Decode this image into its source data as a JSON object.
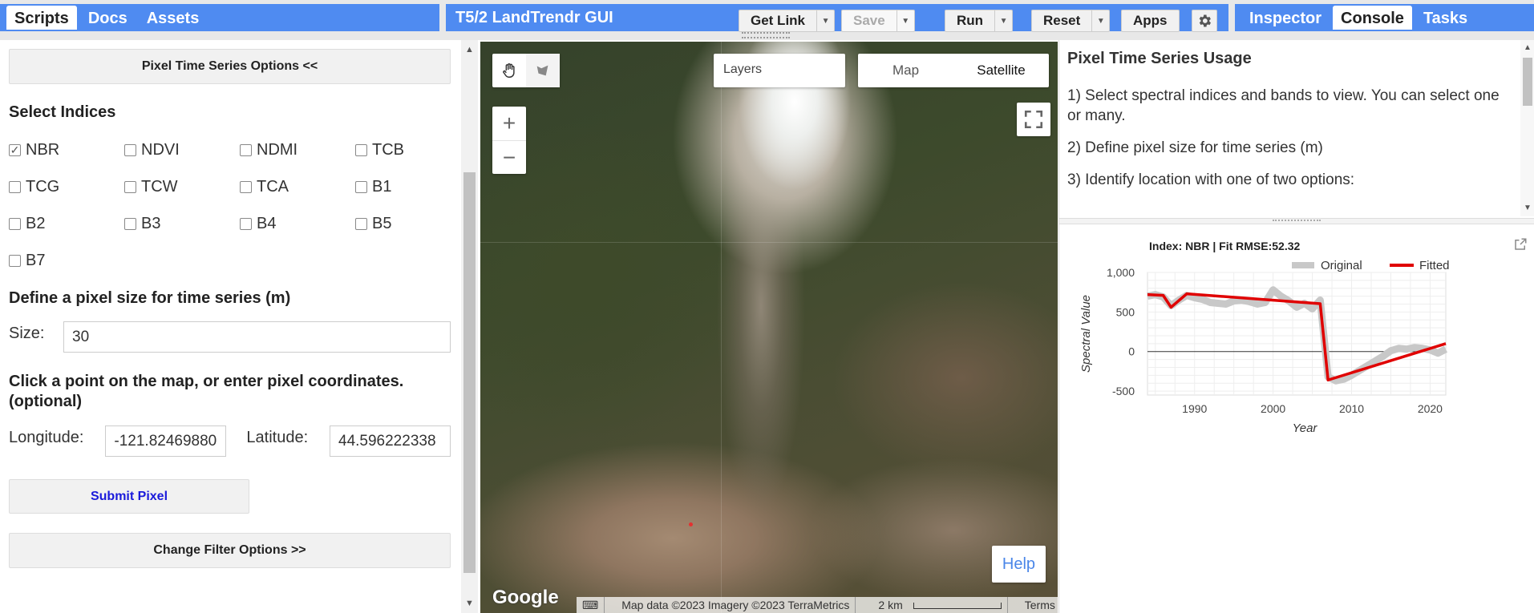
{
  "left_tabs": [
    "Scripts",
    "Docs",
    "Assets"
  ],
  "right_tabs": [
    "Inspector",
    "Console",
    "Tasks"
  ],
  "toolbar": {
    "title": "T5/2 LandTrendr GUI",
    "get_link": "Get Link",
    "save": "Save",
    "run": "Run",
    "reset": "Reset",
    "apps": "Apps"
  },
  "left_panel": {
    "options_button": "Pixel Time Series Options <<",
    "select_indices_heading": "Select Indices",
    "indices": [
      {
        "label": "NBR",
        "checked": true
      },
      {
        "label": "NDVI",
        "checked": false
      },
      {
        "label": "NDMI",
        "checked": false
      },
      {
        "label": "TCB",
        "checked": false
      },
      {
        "label": "TCG",
        "checked": false
      },
      {
        "label": "TCW",
        "checked": false
      },
      {
        "label": "TCA",
        "checked": false
      },
      {
        "label": "B1",
        "checked": false
      },
      {
        "label": "B2",
        "checked": false
      },
      {
        "label": "B3",
        "checked": false
      },
      {
        "label": "B4",
        "checked": false
      },
      {
        "label": "B5",
        "checked": false
      },
      {
        "label": "B7",
        "checked": false
      }
    ],
    "pixel_size_heading": "Define a pixel size for time series (m)",
    "size_label": "Size:",
    "size_value": "30",
    "click_heading": "Click a point on the map, or enter pixel coordinates. (optional)",
    "longitude_label": "Longitude:",
    "longitude_value": "-121.82469880",
    "latitude_label": "Latitude:",
    "latitude_value": "44.596222338",
    "submit_button": "Submit Pixel",
    "filter_button": "Change Filter Options >>"
  },
  "map": {
    "layers_label": "Layers",
    "map_type": [
      "Map",
      "Satellite"
    ],
    "selected_map_type": "Satellite",
    "zoom_in": "+",
    "zoom_out": "−",
    "help": "Help",
    "google": "Google",
    "attribution": "Map data ©2023 Imagery ©2023 TerraMetrics",
    "scale": "2 km",
    "terms": "Terms of Use"
  },
  "right_panel": {
    "usage_title": "Pixel Time Series Usage",
    "usage_steps": [
      "1) Select spectral indices and bands to view. You can select one or many.",
      "2) Define pixel size for time series (m)",
      "3) Identify location with one of two options:"
    ]
  },
  "chart_data": {
    "type": "line",
    "title": "Index: NBR | Fit RMSE:52.32",
    "xlabel": "Year",
    "ylabel": "Spectral Value",
    "xlim": [
      1984,
      2022
    ],
    "ylim": [
      -550,
      1000
    ],
    "xticks": [
      1990,
      2000,
      2010,
      2020
    ],
    "yticks": [
      1000,
      500,
      0,
      -500
    ],
    "ytick_labels": [
      "1,000",
      "500",
      "0",
      "-500"
    ],
    "legend_position": "top-right",
    "series": [
      {
        "name": "Original",
        "color": "#c8c8c8",
        "x": [
          1984,
          1985,
          1986,
          1987,
          1988,
          1989,
          1990,
          1991,
          1992,
          1993,
          1994,
          1995,
          1996,
          1997,
          1998,
          1999,
          2000,
          2001,
          2002,
          2003,
          2004,
          2005,
          2006,
          2007,
          2008,
          2009,
          2010,
          2011,
          2012,
          2013,
          2014,
          2015,
          2016,
          2017,
          2018,
          2019,
          2020,
          2021,
          2022
        ],
        "y": [
          700,
          720,
          690,
          580,
          650,
          710,
          680,
          660,
          620,
          610,
          600,
          640,
          650,
          630,
          600,
          620,
          780,
          700,
          640,
          560,
          610,
          540,
          650,
          -320,
          -370,
          -350,
          -300,
          -240,
          -180,
          -120,
          -60,
          10,
          40,
          30,
          50,
          40,
          20,
          -20,
          30
        ]
      },
      {
        "name": "Fitted",
        "color": "#e00000",
        "x": [
          1984,
          1986,
          1987,
          1989,
          2006,
          2007,
          2022
        ],
        "y": [
          720,
          710,
          560,
          730,
          605,
          -360,
          100
        ]
      }
    ]
  }
}
